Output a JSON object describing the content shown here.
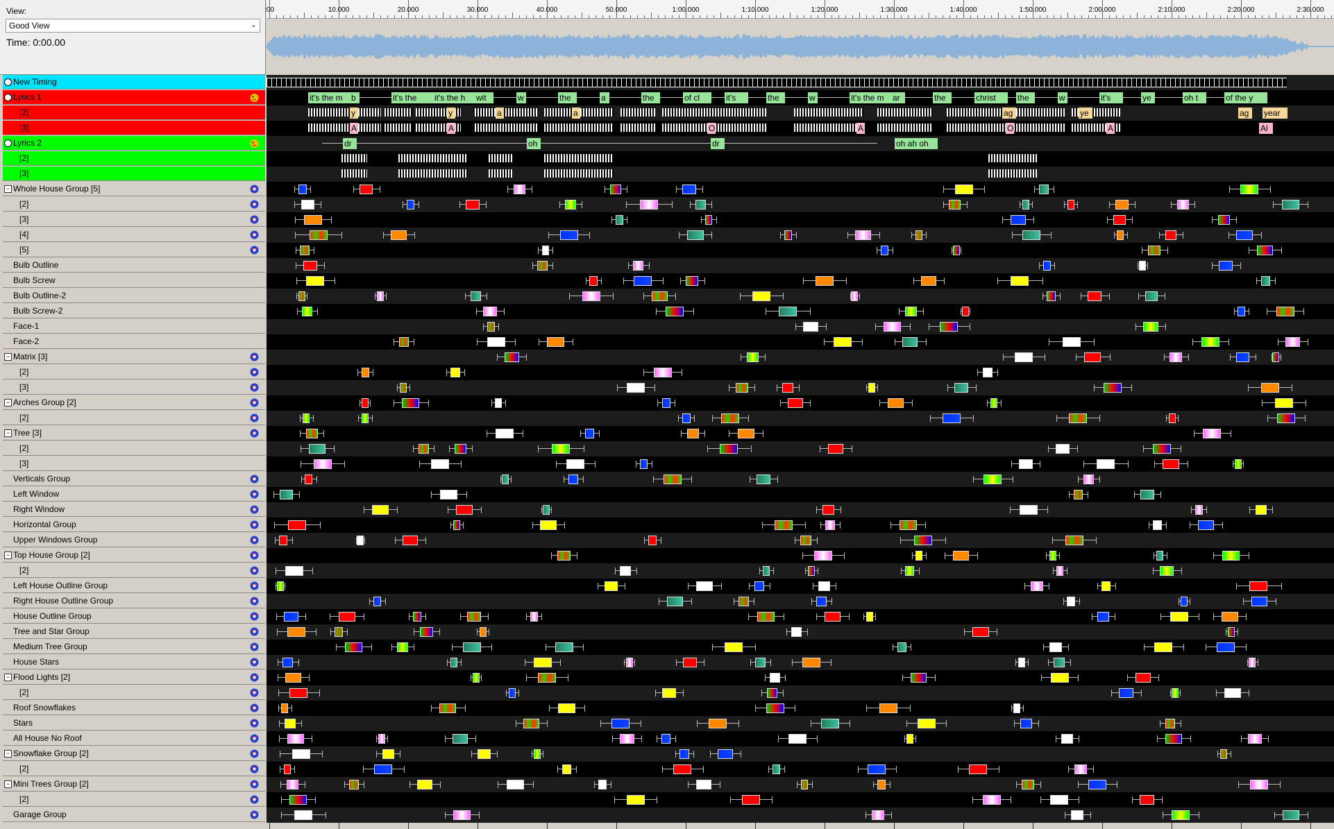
{
  "header": {
    "view_label": "View:",
    "view_value": "Good View",
    "time_label": "Time: 0:00.00"
  },
  "ruler": {
    "ticks": [
      ":00",
      "10.000",
      "20.000",
      "30.000",
      "40.000",
      "50.000",
      "1:00.000",
      "1:10.000",
      "1:20.000",
      "1:30.000",
      "1:40.000",
      "1:50.000",
      "2:00.000",
      "2:10.000",
      "2:20.000",
      "2:30.000"
    ]
  },
  "colors": {
    "timing": "#00e5ff",
    "lyrics1": "#ff0000",
    "lyrics2": "#00ff00",
    "label_bg": "#d4d0c8",
    "waveform": "#8db4d8"
  },
  "rows": [
    {
      "label": "New Timing",
      "style": "cyan",
      "kind": "radio",
      "indent": 0,
      "icon": "none",
      "lane": "timing"
    },
    {
      "label": "Lyrics 1",
      "style": "red",
      "kind": "radio",
      "indent": 0,
      "icon": "lyrics-icon",
      "lane": "lyrics1"
    },
    {
      "label": "[2]",
      "style": "red",
      "kind": "none",
      "indent": 1,
      "icon": "none",
      "lane": "lyrics1b"
    },
    {
      "label": "[3]",
      "style": "red",
      "kind": "none",
      "indent": 1,
      "icon": "none",
      "lane": "lyrics1c"
    },
    {
      "label": "Lyrics 2",
      "style": "green",
      "kind": "radio",
      "indent": 0,
      "icon": "lyrics-icon",
      "lane": "lyrics2"
    },
    {
      "label": "[2]",
      "style": "green",
      "kind": "none",
      "indent": 1,
      "icon": "none",
      "lane": "lyrics2b"
    },
    {
      "label": "[3]",
      "style": "green",
      "kind": "none",
      "indent": 1,
      "icon": "none",
      "lane": "lyrics2c"
    },
    {
      "label": "Whole House Group [5]",
      "style": "",
      "kind": "expander",
      "indent": 0,
      "icon": "model-icon",
      "lane": "fx"
    },
    {
      "label": "[2]",
      "style": "",
      "kind": "none",
      "indent": 1,
      "icon": "model-icon",
      "lane": "fx"
    },
    {
      "label": "[3]",
      "style": "",
      "kind": "none",
      "indent": 1,
      "icon": "model-icon",
      "lane": "fx"
    },
    {
      "label": "[4]",
      "style": "",
      "kind": "none",
      "indent": 1,
      "icon": "model-icon",
      "lane": "fx"
    },
    {
      "label": "[5]",
      "style": "",
      "kind": "none",
      "indent": 1,
      "icon": "model-icon",
      "lane": "fx"
    },
    {
      "label": "Bulb Outline",
      "style": "",
      "kind": "none",
      "indent": 0,
      "icon": "none",
      "lane": "fx"
    },
    {
      "label": "Bulb Screw",
      "style": "",
      "kind": "none",
      "indent": 0,
      "icon": "none",
      "lane": "fx"
    },
    {
      "label": "Bulb Outline-2",
      "style": "",
      "kind": "none",
      "indent": 0,
      "icon": "none",
      "lane": "fx"
    },
    {
      "label": "Bulb Screw-2",
      "style": "",
      "kind": "none",
      "indent": 0,
      "icon": "none",
      "lane": "fx"
    },
    {
      "label": "Face-1",
      "style": "",
      "kind": "none",
      "indent": 0,
      "icon": "none",
      "lane": "fx"
    },
    {
      "label": "Face-2",
      "style": "",
      "kind": "none",
      "indent": 0,
      "icon": "none",
      "lane": "fx"
    },
    {
      "label": "Matrix [3]",
      "style": "",
      "kind": "expander",
      "indent": 0,
      "icon": "model-icon",
      "lane": "fx"
    },
    {
      "label": "[2]",
      "style": "",
      "kind": "none",
      "indent": 1,
      "icon": "model-icon",
      "lane": "fx"
    },
    {
      "label": "[3]",
      "style": "",
      "kind": "none",
      "indent": 1,
      "icon": "model-icon",
      "lane": "fx"
    },
    {
      "label": "Arches Group [2]",
      "style": "",
      "kind": "expander",
      "indent": 0,
      "icon": "model-icon",
      "lane": "fx"
    },
    {
      "label": "[2]",
      "style": "",
      "kind": "none",
      "indent": 1,
      "icon": "model-icon",
      "lane": "fx"
    },
    {
      "label": "Tree [3]",
      "style": "",
      "kind": "expander",
      "indent": 0,
      "icon": "model-icon",
      "lane": "fx"
    },
    {
      "label": "[2]",
      "style": "",
      "kind": "none",
      "indent": 1,
      "icon": "none",
      "lane": "fx"
    },
    {
      "label": "[3]",
      "style": "",
      "kind": "none",
      "indent": 1,
      "icon": "none",
      "lane": "fx"
    },
    {
      "label": "Verticals Group",
      "style": "",
      "kind": "none",
      "indent": 0,
      "icon": "model-icon",
      "lane": "fx"
    },
    {
      "label": "Left Window",
      "style": "",
      "kind": "none",
      "indent": 0,
      "icon": "model-icon",
      "lane": "fx"
    },
    {
      "label": "Right Window",
      "style": "",
      "kind": "none",
      "indent": 0,
      "icon": "model-icon",
      "lane": "fx"
    },
    {
      "label": "Horizontal Group",
      "style": "",
      "kind": "none",
      "indent": 0,
      "icon": "model-icon",
      "lane": "fx"
    },
    {
      "label": "Upper Windows Group",
      "style": "",
      "kind": "none",
      "indent": 0,
      "icon": "model-icon",
      "lane": "fx"
    },
    {
      "label": "Top House Group [2]",
      "style": "",
      "kind": "expander",
      "indent": 0,
      "icon": "model-icon",
      "lane": "fx"
    },
    {
      "label": "[2]",
      "style": "",
      "kind": "none",
      "indent": 1,
      "icon": "model-icon",
      "lane": "fx"
    },
    {
      "label": "Left House Outline Group",
      "style": "",
      "kind": "none",
      "indent": 0,
      "icon": "model-icon",
      "lane": "fx"
    },
    {
      "label": "Right House Outline Group",
      "style": "",
      "kind": "none",
      "indent": 0,
      "icon": "model-icon",
      "lane": "fx"
    },
    {
      "label": "House Outline Group",
      "style": "",
      "kind": "none",
      "indent": 0,
      "icon": "model-icon",
      "lane": "fx"
    },
    {
      "label": "Tree and Star Group",
      "style": "",
      "kind": "none",
      "indent": 0,
      "icon": "model-icon",
      "lane": "fx"
    },
    {
      "label": "Medium Tree Group",
      "style": "",
      "kind": "none",
      "indent": 0,
      "icon": "model-icon",
      "lane": "fx"
    },
    {
      "label": "House Stars",
      "style": "",
      "kind": "none",
      "indent": 0,
      "icon": "model-icon",
      "lane": "fx"
    },
    {
      "label": "Flood Lights [2]",
      "style": "",
      "kind": "expander",
      "indent": 0,
      "icon": "model-icon",
      "lane": "fx"
    },
    {
      "label": "[2]",
      "style": "",
      "kind": "none",
      "indent": 1,
      "icon": "model-icon",
      "lane": "fx"
    },
    {
      "label": "Roof Snowflakes",
      "style": "",
      "kind": "none",
      "indent": 0,
      "icon": "model-icon",
      "lane": "fx"
    },
    {
      "label": "Stars",
      "style": "",
      "kind": "none",
      "indent": 0,
      "icon": "model-icon",
      "lane": "fx"
    },
    {
      "label": "All House No Roof",
      "style": "",
      "kind": "none",
      "indent": 0,
      "icon": "model-icon",
      "lane": "fx"
    },
    {
      "label": "Snowflake Group [2]",
      "style": "",
      "kind": "expander",
      "indent": 0,
      "icon": "model-icon",
      "lane": "fx"
    },
    {
      "label": "[2]",
      "style": "",
      "kind": "none",
      "indent": 1,
      "icon": "model-icon",
      "lane": "fx"
    },
    {
      "label": "Mini Trees Group [2]",
      "style": "",
      "kind": "expander",
      "indent": 0,
      "icon": "model-icon",
      "lane": "fx"
    },
    {
      "label": "[2]",
      "style": "",
      "kind": "none",
      "indent": 1,
      "icon": "model-icon",
      "lane": "fx"
    },
    {
      "label": "Garage Group",
      "style": "",
      "kind": "none",
      "indent": 0,
      "icon": "model-icon",
      "lane": "fx"
    }
  ],
  "lyrics": {
    "lyrics1_words": [
      "it's the m",
      "b",
      "it's the",
      "it's the h",
      "wit",
      "w",
      "the",
      "a",
      "the",
      "of cl",
      "it's",
      "the",
      "w",
      "it's the m",
      "ar",
      "the",
      "christ",
      "the",
      "w",
      "it's",
      "ye",
      "oh t",
      "of the y"
    ],
    "lyrics1b_words": [
      "y",
      "y",
      "a",
      "a",
      "ag",
      "ye",
      "ag",
      "year"
    ],
    "lyrics1c_words": [
      "A",
      "A",
      "O",
      "A",
      "O",
      "A",
      "Al"
    ],
    "lyrics2_words": [
      "dr",
      "oh",
      "dr",
      "oh ah oh"
    ]
  }
}
